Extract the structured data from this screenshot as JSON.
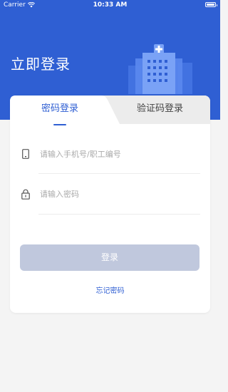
{
  "status_bar": {
    "carrier": "Carrier",
    "time": "10:33 AM"
  },
  "header": {
    "title": "立即登录"
  },
  "tabs": [
    {
      "label": "密码登录",
      "active": true
    },
    {
      "label": "验证码登录",
      "active": false
    }
  ],
  "form": {
    "username_placeholder": "请输入手机号/职工编号",
    "username_value": "",
    "password_placeholder": "请输入密码",
    "password_value": ""
  },
  "login_button": {
    "label": "登录"
  },
  "forgot_link": {
    "label": "忘记密码"
  },
  "colors": {
    "primary": "#2f5fd3",
    "button_disabled": "#c0c8dd",
    "background": "#f4f4f4"
  },
  "icons": [
    "wifi-icon",
    "battery-icon",
    "hospital-icon",
    "phone-icon",
    "lock-icon"
  ]
}
